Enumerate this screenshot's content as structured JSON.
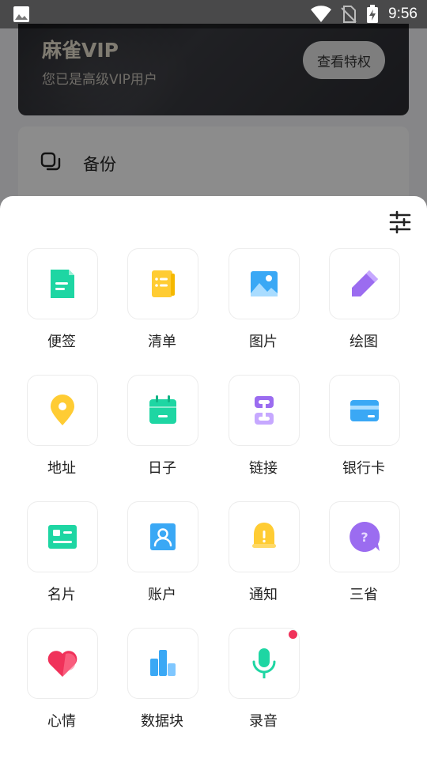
{
  "status_bar": {
    "time": "9:56",
    "icons": [
      "image-icon",
      "wifi-icon",
      "no-sim-icon",
      "battery-charging-icon"
    ]
  },
  "background": {
    "vip_title": "麻雀VIP",
    "vip_subtitle": "您已是高级VIP用户",
    "vip_button": "查看特权",
    "backup_label": "备份"
  },
  "sheet": {
    "settings_icon": "sliders-icon",
    "items": [
      {
        "label": "便签",
        "icon": "note-icon",
        "color": "#1ed6a3"
      },
      {
        "label": "清单",
        "icon": "checklist-icon",
        "color": "#ffcc33"
      },
      {
        "label": "图片",
        "icon": "picture-icon",
        "color": "#3aa8f5"
      },
      {
        "label": "绘图",
        "icon": "pencil-icon",
        "color": "#9b6cf0"
      },
      {
        "label": "地址",
        "icon": "location-pin-icon",
        "color": "#ffcc33"
      },
      {
        "label": "日子",
        "icon": "calendar-icon",
        "color": "#1ed6a3"
      },
      {
        "label": "链接",
        "icon": "link-icon",
        "color": "#9b6cf0"
      },
      {
        "label": "银行卡",
        "icon": "bank-card-icon",
        "color": "#3aa8f5"
      },
      {
        "label": "名片",
        "icon": "business-card-icon",
        "color": "#1ed6a3"
      },
      {
        "label": "账户",
        "icon": "account-icon",
        "color": "#3aa8f5"
      },
      {
        "label": "通知",
        "icon": "bell-icon",
        "color": "#ffcc33"
      },
      {
        "label": "三省",
        "icon": "question-bubble-icon",
        "color": "#9b6cf0"
      },
      {
        "label": "心情",
        "icon": "heart-icon",
        "color": "#f0325a"
      },
      {
        "label": "数据块",
        "icon": "bar-chart-icon",
        "color": "#3aa8f5"
      },
      {
        "label": "录音",
        "icon": "microphone-icon",
        "color": "#1ed6a3",
        "badge": true
      }
    ]
  }
}
